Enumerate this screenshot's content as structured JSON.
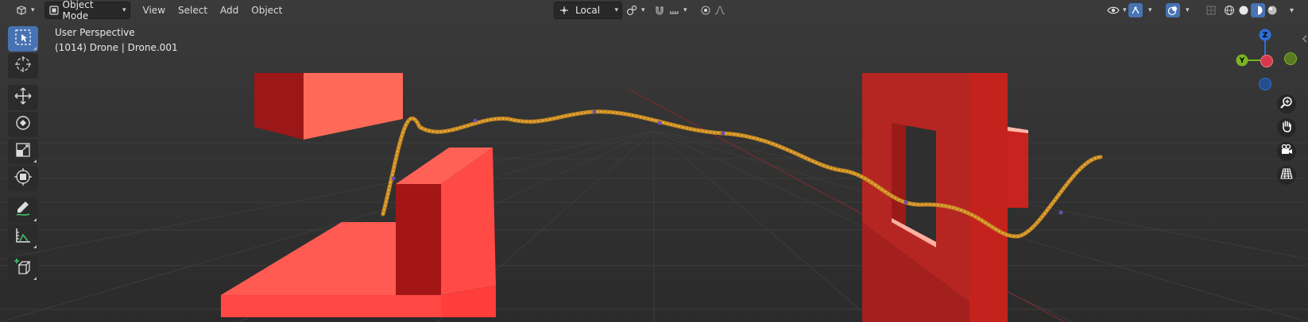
{
  "header": {
    "mode_label": "Object Mode",
    "menus": [
      "View",
      "Select",
      "Add",
      "Object"
    ],
    "transform_orientation": "Local"
  },
  "overlay": {
    "view_name": "User Perspective",
    "object_info": "(1014) Drone | Drone.001"
  },
  "gizmo": {
    "z_label": "Z",
    "y_label": "Y"
  },
  "colors": {
    "viewport_bg": "#2f2f2f",
    "obstacle_light": "#ff5f52",
    "obstacle_dark": "#a01515",
    "path": "#d29a2a",
    "accent": "#4772b3"
  },
  "icons": {
    "editor_type": "view3d-icon",
    "tools": [
      "select-box-icon",
      "cursor-icon",
      "move-icon",
      "rotate-icon",
      "scale-icon",
      "transform-icon",
      "annotate-icon",
      "measure-icon",
      "add-cube-icon"
    ],
    "nav": [
      "zoom-icon",
      "hand-pan-icon",
      "camera-icon",
      "grid-icon"
    ]
  }
}
